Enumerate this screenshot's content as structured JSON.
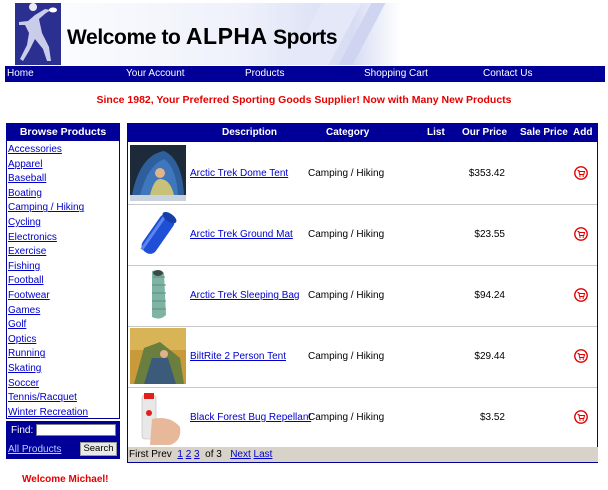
{
  "banner": {
    "title_prefix": "Welcome to ",
    "title_brand": "ALPHA",
    "title_suffix": " Sports"
  },
  "nav": {
    "items": [
      "Home",
      "Your Account",
      "Products",
      "Shopping Cart",
      "Contact Us"
    ]
  },
  "tagline": "Since 1982, Your Preferred Sporting Goods Supplier! Now with Many New Products",
  "sidebar": {
    "title": "Browse Products",
    "categories": [
      "Accessories",
      "Apparel",
      "Baseball",
      "Boating",
      "Camping / Hiking",
      "Cycling",
      "Electronics",
      "Exercise",
      "Fishing",
      "Football",
      "Footwear",
      "Games",
      "Golf",
      "Optics",
      "Running",
      "Skating",
      "Soccer",
      "Tennis/Racquet",
      "Winter Recreation"
    ]
  },
  "find": {
    "label": "Find:",
    "value": "",
    "all_products": "All Products",
    "search_button": "Search"
  },
  "table": {
    "headers": {
      "description": "Description",
      "category": "Category",
      "list": "List",
      "our_price": "Our Price",
      "sale_price": "Sale Price",
      "add": "Add"
    },
    "rows": [
      {
        "name": "Arctic Trek Dome Tent",
        "category": "Camping / Hiking",
        "list": "",
        "price": "$353.42",
        "sale": "",
        "image": "tent-photo"
      },
      {
        "name": "Arctic Trek Ground Mat",
        "category": "Camping / Hiking",
        "list": "",
        "price": "$23.55",
        "sale": "",
        "image": "ground-mat-photo"
      },
      {
        "name": "Arctic Trek Sleeping Bag",
        "category": "Camping / Hiking",
        "list": "",
        "price": "$94.24",
        "sale": "",
        "image": "sleeping-bag-photo"
      },
      {
        "name": "BiltRite 2 Person Tent",
        "category": "Camping / Hiking",
        "list": "",
        "price": "$29.44",
        "sale": "",
        "image": "two-person-tent-photo"
      },
      {
        "name": "Black Forest Bug Repellant",
        "category": "Camping / Hiking",
        "list": "",
        "price": "$3.52",
        "sale": "",
        "image": "bug-repellant-photo"
      }
    ]
  },
  "pager": {
    "first": "First",
    "prev": "Prev",
    "pages": [
      "1",
      "2",
      "3"
    ],
    "of_label": "of 3",
    "next": "Next",
    "last": "Last"
  },
  "welcome": "Welcome Michael!",
  "colors": {
    "nav_bg": "#000099",
    "accent_red": "#e60000",
    "link": "#0000cc"
  }
}
